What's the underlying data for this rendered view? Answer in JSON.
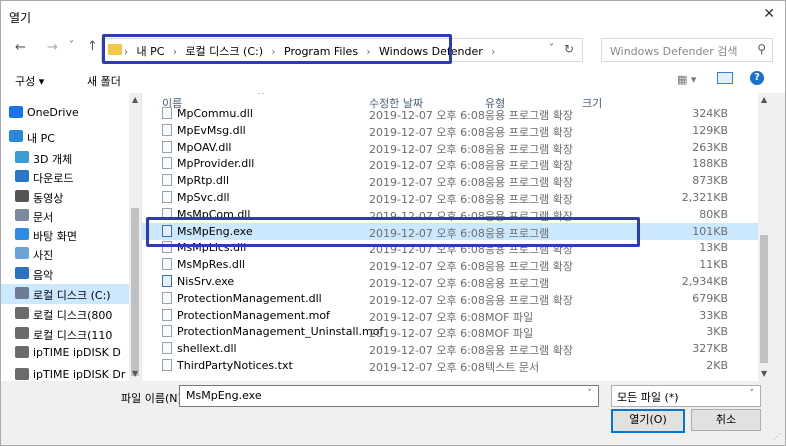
{
  "window": {
    "title": "열기",
    "close_glyph": "✕"
  },
  "nav": {
    "back": "←",
    "forward": "→",
    "recent": "˅",
    "up": "↑"
  },
  "address": {
    "crumbs": [
      "내 PC",
      "로컬 디스크 (C:)",
      "Program Files",
      "Windows Defender"
    ],
    "separator": "›"
  },
  "search": {
    "placeholder": "Windows Defender 검색"
  },
  "toolbar": {
    "organize": "구성 ▾",
    "new_folder": "새 폴더",
    "view_glyph": "▦ ▾"
  },
  "sidebar": {
    "items": [
      {
        "label": "OneDrive",
        "color": "#1a73e8"
      },
      {
        "label": "내 PC",
        "color": "#2b89d9"
      },
      {
        "label": "3D 개체",
        "color": "#3a9bd5"
      },
      {
        "label": "다운로드",
        "color": "#2776c7"
      },
      {
        "label": "동영상",
        "color": "#555555"
      },
      {
        "label": "문서",
        "color": "#7a8aa0"
      },
      {
        "label": "바탕 화면",
        "color": "#2e8be6"
      },
      {
        "label": "사진",
        "color": "#6aa3d8"
      },
      {
        "label": "음악",
        "color": "#2b73c2"
      },
      {
        "label": "로컬 디스크 (C:)",
        "color": "#6b7c93"
      },
      {
        "label": "로컬 디스크(800",
        "color": "#6b6b6b"
      },
      {
        "label": "로컬 디스크(110",
        "color": "#6b6b6b"
      },
      {
        "label": "ipTIME ipDISK D",
        "color": "#6b6b6b"
      },
      {
        "label": "ipTIME ipDISK Dr",
        "color": "#6b6b6b"
      }
    ]
  },
  "columns": {
    "name": "이름",
    "date": "수정한 날짜",
    "type": "유형",
    "size": "크기"
  },
  "files": [
    {
      "name": "MpCommu.dll",
      "date": "2019-12-07 오후 6:08",
      "type": "응용 프로그램 확장",
      "size": "324KB",
      "icon": "dll"
    },
    {
      "name": "MpEvMsg.dll",
      "date": "2019-12-07 오후 6:08",
      "type": "응용 프로그램 확장",
      "size": "129KB",
      "icon": "dll"
    },
    {
      "name": "MpOAV.dll",
      "date": "2019-12-07 오후 6:08",
      "type": "응용 프로그램 확장",
      "size": "263KB",
      "icon": "dll"
    },
    {
      "name": "MpProvider.dll",
      "date": "2019-12-07 오후 6:08",
      "type": "응용 프로그램 확장",
      "size": "188KB",
      "icon": "dll"
    },
    {
      "name": "MpRtp.dll",
      "date": "2019-12-07 오후 6:08",
      "type": "응용 프로그램 확장",
      "size": "873KB",
      "icon": "dll"
    },
    {
      "name": "MpSvc.dll",
      "date": "2019-12-07 오후 6:08",
      "type": "응용 프로그램 확장",
      "size": "2,321KB",
      "icon": "dll"
    },
    {
      "name": "MsMpCom.dll",
      "date": "2019-12-07 오후 6:08",
      "type": "응용 프로그램 확장",
      "size": "80KB",
      "icon": "dll"
    },
    {
      "name": "MsMpEng.exe",
      "date": "2019-12-07 오후 6:08",
      "type": "응용 프로그램",
      "size": "101KB",
      "icon": "exe",
      "selected": true
    },
    {
      "name": "MsMpLics.dll",
      "date": "2019-12-07 오후 6:08",
      "type": "응용 프로그램 확장",
      "size": "13KB",
      "icon": "dll"
    },
    {
      "name": "MsMpRes.dll",
      "date": "2019-12-07 오후 6:08",
      "type": "응용 프로그램 확장",
      "size": "11KB",
      "icon": "dll"
    },
    {
      "name": "NisSrv.exe",
      "date": "2019-12-07 오후 6:08",
      "type": "응용 프로그램",
      "size": "2,934KB",
      "icon": "exe"
    },
    {
      "name": "ProtectionManagement.dll",
      "date": "2019-12-07 오후 6:08",
      "type": "응용 프로그램 확장",
      "size": "679KB",
      "icon": "dll"
    },
    {
      "name": "ProtectionManagement.mof",
      "date": "2019-12-07 오후 6:08",
      "type": "MOF 파일",
      "size": "33KB",
      "icon": "file"
    },
    {
      "name": "ProtectionManagement_Uninstall.mof",
      "date": "2019-12-07 오후 6:08",
      "type": "MOF 파일",
      "size": "3KB",
      "icon": "file"
    },
    {
      "name": "shellext.dll",
      "date": "2019-12-07 오후 6:08",
      "type": "응용 프로그램 확장",
      "size": "327KB",
      "icon": "dll"
    },
    {
      "name": "ThirdPartyNotices.txt",
      "date": "2019-12-07 오후 6:08",
      "type": "텍스트 문서",
      "size": "2KB",
      "icon": "file"
    }
  ],
  "footer": {
    "filename_label": "파일 이름(N):",
    "filename_value": "MsMpEng.exe",
    "filetype": "모든 파일 (*)",
    "open": "열기(O)",
    "cancel": "취소"
  },
  "colors": {
    "highlight": "#2d3bb5",
    "selection": "#cce8ff"
  }
}
